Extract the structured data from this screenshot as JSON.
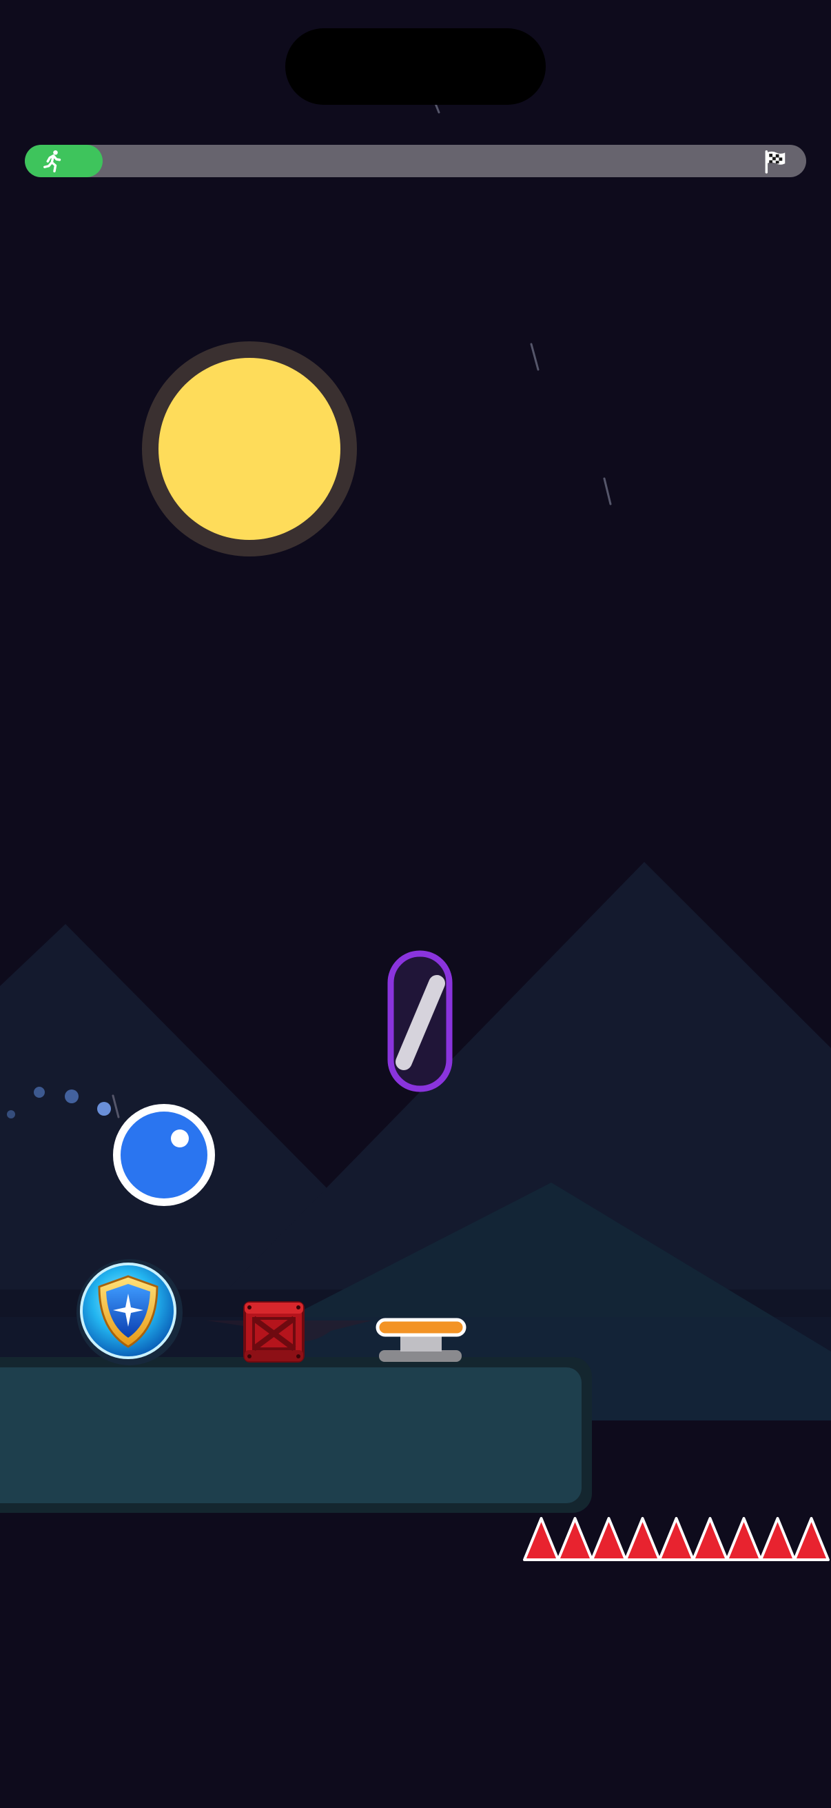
{
  "game": {
    "level_progress": 0.1,
    "progress_start_icon": "runner-icon",
    "progress_end_icon": "checkered-flag-icon"
  },
  "colors": {
    "background": "#0e0b1c",
    "progress_track": "#67646e",
    "progress_fill": "#3ec45c",
    "sun": "#fedc5a",
    "player_ball": "#2a75f0",
    "platform": "#1e3f4d",
    "spikes": "#e8232f",
    "portal": "#8a34dd",
    "spring": "#f39325"
  },
  "scene": {
    "objects": [
      {
        "name": "player-ball",
        "icon": "blue-ball"
      },
      {
        "name": "shield-powerup",
        "icon": "shield-icon"
      },
      {
        "name": "tnt-crate",
        "icon": "red-crate-icon"
      },
      {
        "name": "spring-pad",
        "icon": "spring-icon"
      },
      {
        "name": "gravity-portal",
        "icon": "portal-icon"
      },
      {
        "name": "spike-row",
        "icon": "spike-icon",
        "count": 9
      }
    ]
  }
}
